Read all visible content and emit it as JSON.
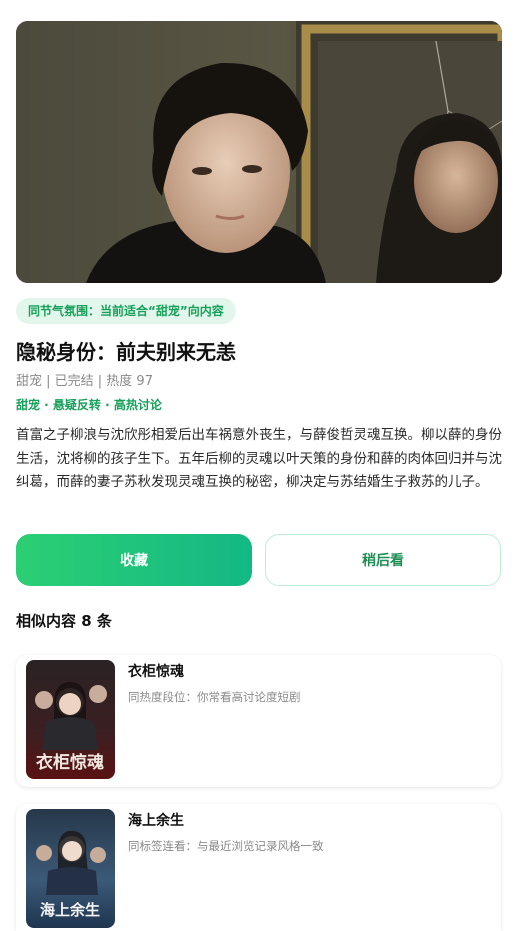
{
  "detail": {
    "hero_image": "hero-poster-image",
    "atmosphere_pill": "同节气氛围：当前适合“甜宠”向内容",
    "title": "隐秘身份：前夫别来无恙",
    "meta": "甜宠 | 已完结 | 热度 97",
    "tags": "甜宠 · 悬疑反转 · 高热讨论",
    "description": "首富之子柳浪与沈欣彤相爱后出车祸意外丧生，与薛俊哲灵魂互换。柳以薛的身份生活，沈将柳的孩子生下。五年后柳的灵魂以叶天策的身份和薛的肉体回归并与沈纠葛，而薛的妻子苏秋发现灵魂互换的秘密，柳决定与苏结婚生子救苏的儿子。"
  },
  "actions": {
    "favorite_label": "收藏",
    "watch_later_label": "稍后看"
  },
  "similar": {
    "heading": "相似内容 8 条",
    "items": [
      {
        "title": "衣柜惊魂",
        "reason": "同热度段位：你常看高讨论度短剧",
        "poster_text": "衣柜惊魂"
      },
      {
        "title": "海上余生",
        "reason": "同标签连看：与最近浏览记录风格一致",
        "poster_text": "海上余生"
      }
    ]
  },
  "colors": {
    "accent": "#17a05a",
    "button_gradient_start": "#2ccf73",
    "button_gradient_end": "#13b884",
    "pill_bg": "#e3f6ec"
  }
}
